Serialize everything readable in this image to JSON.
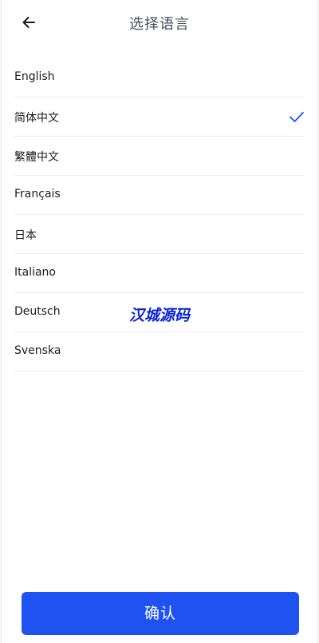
{
  "header": {
    "title": "选择语言",
    "back_icon": "arrow-left-icon"
  },
  "languages": [
    {
      "label": "English",
      "selected": false
    },
    {
      "label": "简体中文",
      "selected": true
    },
    {
      "label": "繁體中文",
      "selected": false
    },
    {
      "label": "Français",
      "selected": false
    },
    {
      "label": "日本",
      "selected": false
    },
    {
      "label": "Italiano",
      "selected": false
    },
    {
      "label": "Deutsch",
      "selected": false
    },
    {
      "label": "Svenska",
      "selected": false
    }
  ],
  "watermark": "汉城源码",
  "confirm_label": "确认",
  "colors": {
    "accent": "#1e52f1",
    "check": "#1e52f1",
    "watermark": "#0a23d6"
  }
}
